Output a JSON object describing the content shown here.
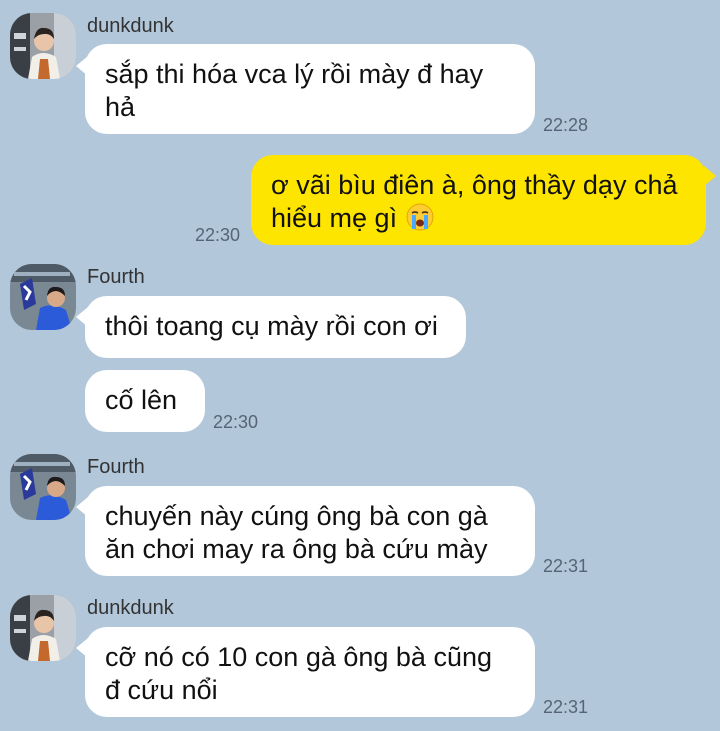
{
  "chat": {
    "messages": [
      {
        "sender": "dunkdunk",
        "text_lines": [
          "sắp thi hóa vca lý rồi mày đ hay",
          "hả"
        ],
        "time": "22:28"
      },
      {
        "sender": "me",
        "text_lines": [
          "ơ vãi bìu điên à, ông thầy dạy chả",
          "hiểu mẹ gì"
        ],
        "emoji": "loudly-crying-face-emoji",
        "time": "22:30"
      },
      {
        "sender": "Fourth",
        "text_lines": [
          "thôi toang cụ mày rồi con ơi"
        ]
      },
      {
        "sender": "Fourth",
        "text_lines": [
          "cố lên"
        ],
        "time": "22:30"
      },
      {
        "sender": "Fourth",
        "text_lines": [
          "chuyến này cúng ông bà con gà",
          "ăn chơi may ra ông bà cứu mày"
        ],
        "time": "22:31"
      },
      {
        "sender": "dunkdunk",
        "text_lines": [
          "cỡ nó có 10 con gà ông bà cũng",
          "đ cứu nổi"
        ],
        "time": "22:31"
      }
    ]
  },
  "colors": {
    "background": "#b2c7da",
    "incoming_bubble": "#ffffff",
    "outgoing_bubble": "#fee500",
    "timestamp": "#556575"
  }
}
